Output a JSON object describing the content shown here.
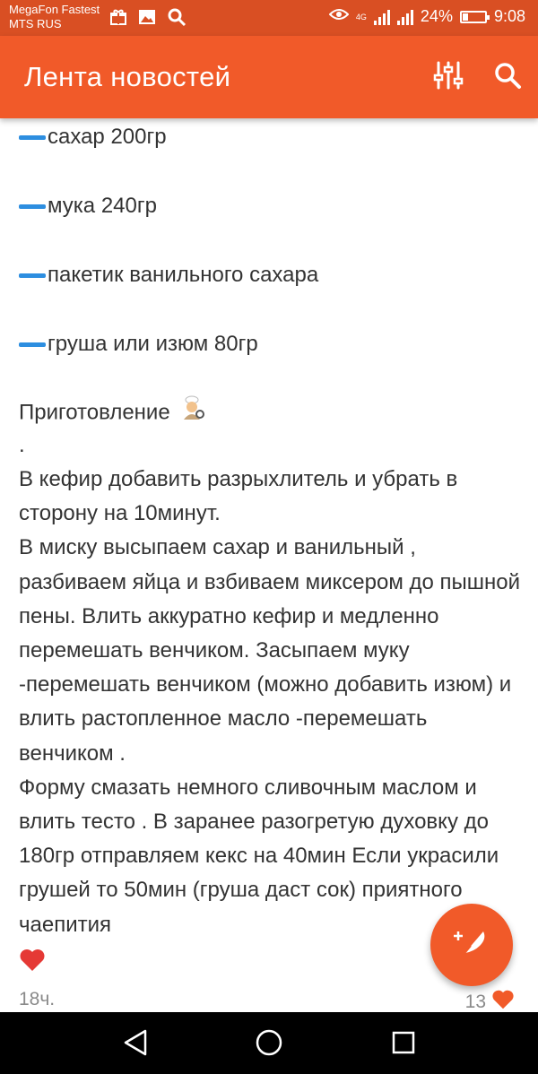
{
  "status_bar": {
    "carrier1": "MegaFon Fastest",
    "carrier2": "MTS RUS",
    "network": "4G",
    "battery": "24%",
    "battery_level": 0.24,
    "time": "9:08"
  },
  "app_bar": {
    "title": "Лента новостей",
    "filter_icon": "sliders-icon",
    "search_icon": "search-icon"
  },
  "post": {
    "ingredients": [
      "сахар 200гр",
      "мука 240гр",
      "пакетик ванильного сахара",
      "груша или изюм 80гр"
    ],
    "prep_title": "Приготовление",
    "dot": ".",
    "paragraph1": "В кефир добавить разрыхлитель и убрать в сторону на 10минут.",
    "paragraph2": "В миску высыпаем сахар и ванильный , разбиваем яйца и взбиваем миксером до пышной пены. Влить аккуратно кефир и медленно перемешать венчиком. Засыпаем муку -перемешать венчиком (можно добавить изюм) и влить растопленное масло -перемешать венчиком .",
    "paragraph3": "Форму смазать немного сливочным маслом и влить тесто . В заранее разогретую духовку до 180гр отправляем кекс на 40мин Если украсили грушей то 50мин (груша даст сок) приятного чаепития",
    "heart": "❤️",
    "time_ago": "18ч.",
    "likes": "13"
  },
  "colors": {
    "status_bar": "#d94f23",
    "app_bar": "#f15a29",
    "accent_dash": "#2d8ee0",
    "text": "#333333",
    "heart": "#e53935"
  }
}
